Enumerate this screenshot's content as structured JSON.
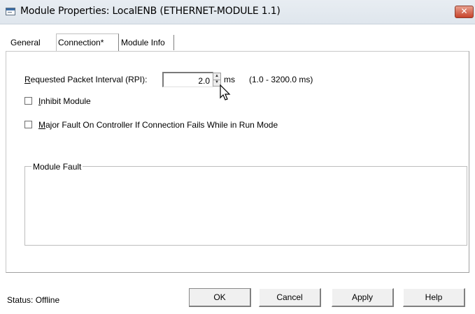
{
  "window": {
    "title": "Module Properties: LocalENB (ETHERNET-MODULE 1.1)",
    "close_glyph": "✕"
  },
  "tabs": [
    {
      "label": "General",
      "active": false
    },
    {
      "label": "Connection*",
      "active": true
    },
    {
      "label": "Module Info",
      "active": false
    }
  ],
  "connection": {
    "rpi_label_first": "R",
    "rpi_label_rest": "equested Packet Interval (RPI):",
    "rpi_value": "2.0",
    "rpi_unit": "ms",
    "rpi_range": "(1.0 - 3200.0 ms)",
    "inhibit_first": "I",
    "inhibit_rest": "nhibit Module",
    "inhibit_checked": false,
    "major_first": "M",
    "major_rest": "ajor Fault On Controller If Connection Fails While in Run Mode",
    "major_checked": false,
    "module_fault_legend": "Module Fault",
    "module_fault_text": ""
  },
  "footer": {
    "status": "Status:  Offline",
    "ok_label": "OK",
    "cancel_label": "Cancel",
    "apply_label": "Apply",
    "help_label": "Help"
  },
  "icons": {
    "app": "module-window-icon",
    "close": "close-icon",
    "spin_up": "spin-up-icon",
    "spin_down": "spin-down-icon",
    "cursor": "mouse-pointer-icon"
  },
  "colors": {
    "titlebar": "#e8edf2",
    "close_button": "#c7432b",
    "panel_bg": "#ffffff"
  }
}
